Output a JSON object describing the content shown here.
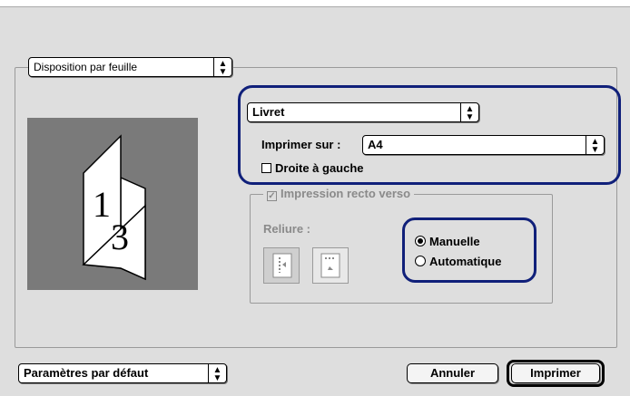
{
  "panel_selector": {
    "value": "Disposition par feuille"
  },
  "layout": {
    "type_value": "Livret",
    "print_on_label": "Imprimer sur :",
    "print_on_value": "A4",
    "right_to_left_label": "Droite à gauche",
    "right_to_left_checked": false
  },
  "preview": {
    "page_front": "1",
    "page_back": "3"
  },
  "duplex": {
    "label": "Impression recto verso",
    "checked": true,
    "binding_label": "Reliure :",
    "modes": [
      {
        "label": "Manuelle",
        "selected": true
      },
      {
        "label": "Automatique",
        "selected": false
      }
    ]
  },
  "footer": {
    "presets_value": "Paramètres par défaut",
    "cancel_label": "Annuler",
    "print_label": "Imprimer"
  },
  "colors": {
    "highlight": "#10207a",
    "preview_bg": "#7a7a7a"
  }
}
